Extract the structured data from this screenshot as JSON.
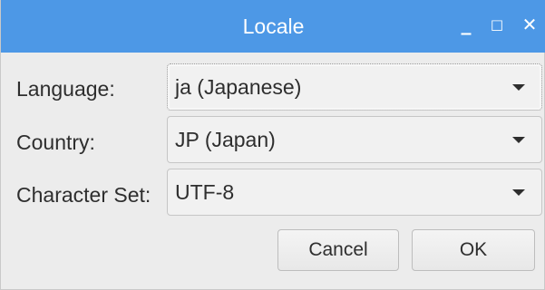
{
  "window": {
    "title": "Locale",
    "controls": {
      "minimize": "_",
      "maximize": "□",
      "close": "✕"
    }
  },
  "fields": {
    "language": {
      "label": "Language:",
      "value": "ja (Japanese)"
    },
    "country": {
      "label": "Country:",
      "value": "JP (Japan)"
    },
    "charset": {
      "label": "Character Set:",
      "value": "UTF-8"
    }
  },
  "buttons": {
    "cancel": "Cancel",
    "ok": "OK"
  },
  "icons": {
    "dropdown": "chevron-down-icon",
    "minimize": "minimize-icon",
    "maximize": "maximize-icon",
    "close": "close-icon"
  },
  "colors": {
    "titlebar": "#4d98e6",
    "window_background": "#ececec",
    "text": "#2e2e2e"
  }
}
